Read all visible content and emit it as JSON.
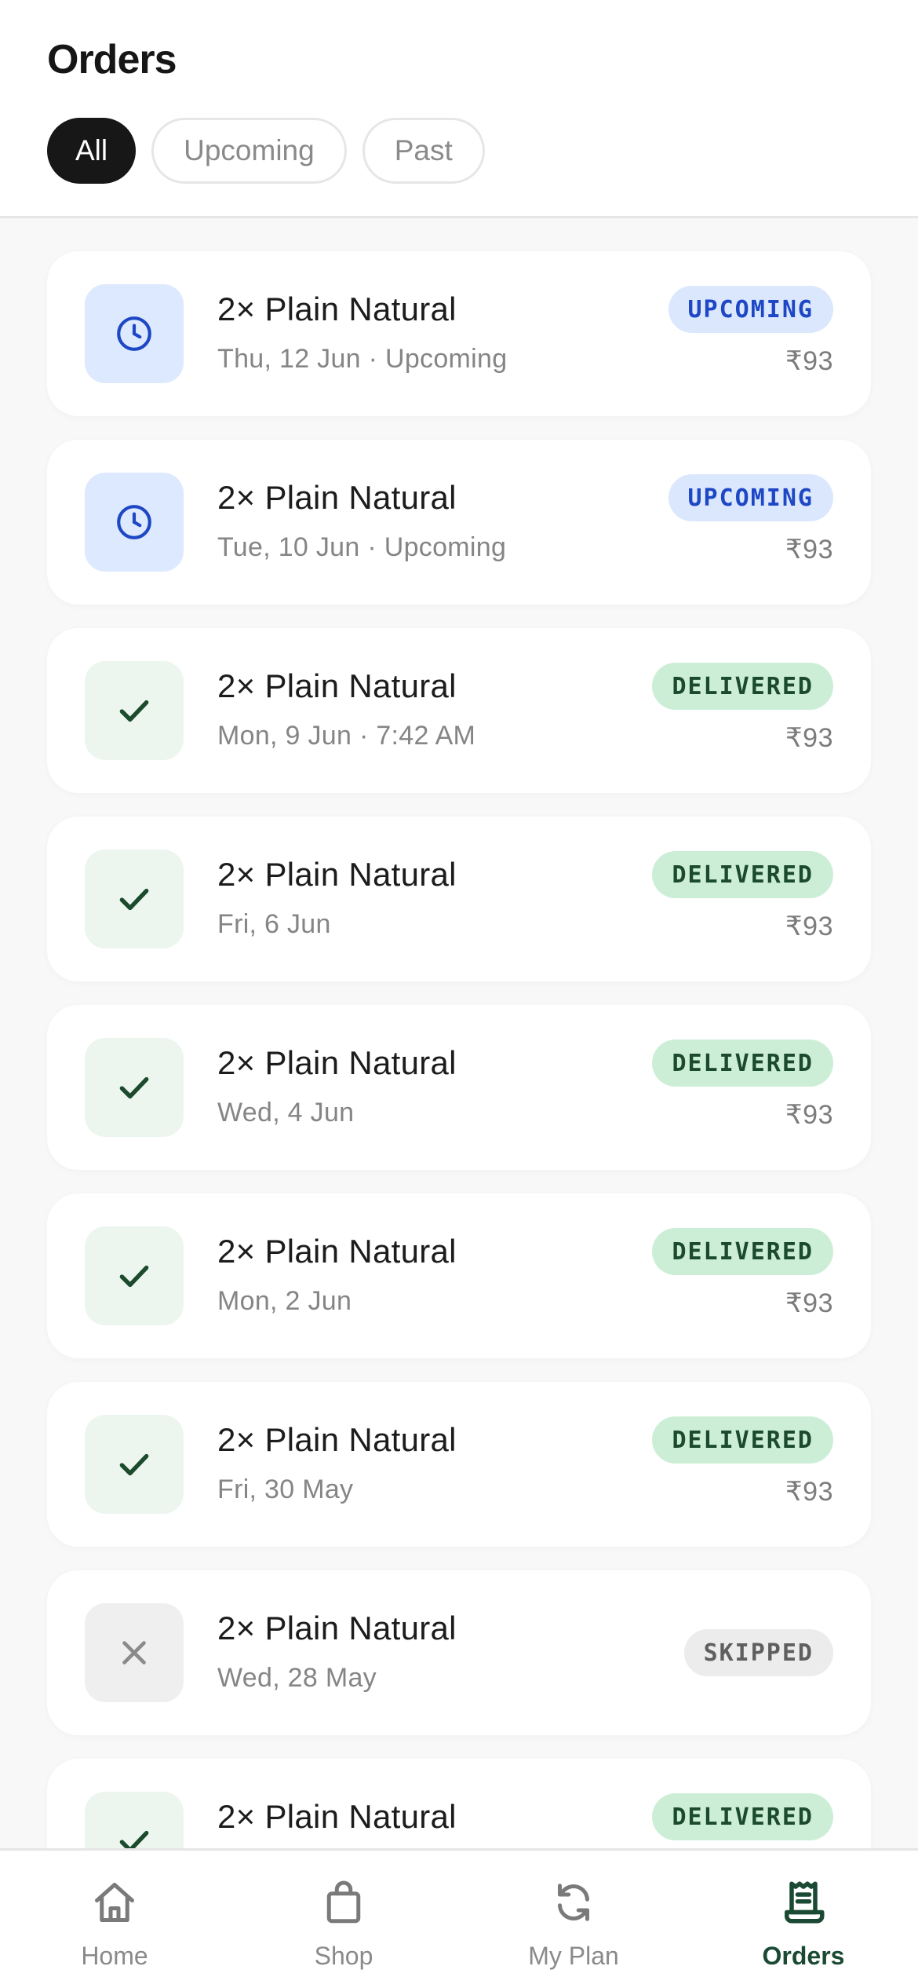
{
  "header": {
    "title": "Orders",
    "filters": [
      {
        "label": "All",
        "active": true
      },
      {
        "label": "Upcoming",
        "active": false
      },
      {
        "label": "Past",
        "active": false
      }
    ]
  },
  "orders": [
    {
      "name": "2× Plain Natural",
      "subtitle": "Thu, 12 Jun · Upcoming",
      "status": "UPCOMING",
      "status_key": "upcoming",
      "icon": "clock-icon",
      "price": "₹93"
    },
    {
      "name": "2× Plain Natural",
      "subtitle": "Tue, 10 Jun · Upcoming",
      "status": "UPCOMING",
      "status_key": "upcoming",
      "icon": "clock-icon",
      "price": "₹93"
    },
    {
      "name": "2× Plain Natural",
      "subtitle": "Mon, 9 Jun · 7:42 AM",
      "status": "DELIVERED",
      "status_key": "delivered",
      "icon": "check-icon",
      "price": "₹93"
    },
    {
      "name": "2× Plain Natural",
      "subtitle": "Fri, 6 Jun",
      "status": "DELIVERED",
      "status_key": "delivered",
      "icon": "check-icon",
      "price": "₹93"
    },
    {
      "name": "2× Plain Natural",
      "subtitle": "Wed, 4 Jun",
      "status": "DELIVERED",
      "status_key": "delivered",
      "icon": "check-icon",
      "price": "₹93"
    },
    {
      "name": "2× Plain Natural",
      "subtitle": "Mon, 2 Jun",
      "status": "DELIVERED",
      "status_key": "delivered",
      "icon": "check-icon",
      "price": "₹93"
    },
    {
      "name": "2× Plain Natural",
      "subtitle": "Fri, 30 May",
      "status": "DELIVERED",
      "status_key": "delivered",
      "icon": "check-icon",
      "price": "₹93"
    },
    {
      "name": "2× Plain Natural",
      "subtitle": "Wed, 28 May",
      "status": "SKIPPED",
      "status_key": "skipped",
      "icon": "x-icon",
      "price": ""
    },
    {
      "name": "2× Plain Natural",
      "subtitle": "",
      "status": "DELIVERED",
      "status_key": "delivered",
      "icon": "check-icon",
      "price": ""
    }
  ],
  "nav": [
    {
      "label": "Home",
      "icon": "home-icon",
      "active": false
    },
    {
      "label": "Shop",
      "icon": "shopping-bag-icon",
      "active": false
    },
    {
      "label": "My Plan",
      "icon": "refresh-icon",
      "active": false
    },
    {
      "label": "Orders",
      "icon": "receipt-icon",
      "active": true
    }
  ],
  "colors": {
    "accent_dark": "#171717",
    "upcoming_blue": "#1d47c4",
    "delivered_green": "#1b4a2c",
    "skipped_gray": "#5f5f5f",
    "nav_active": "#1a4a33"
  }
}
